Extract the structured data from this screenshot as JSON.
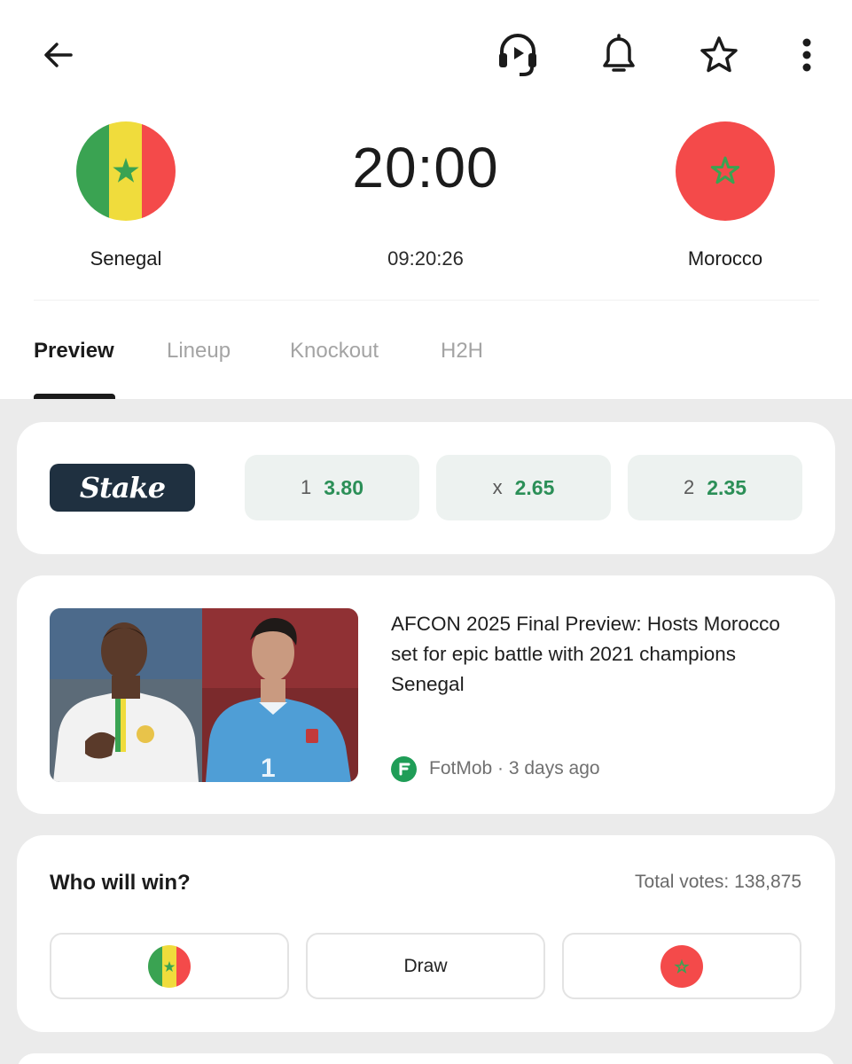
{
  "header": {
    "back_icon": "arrow-left-icon",
    "actions": [
      "headset-play-icon",
      "bell-icon",
      "star-icon",
      "more-vertical-icon"
    ]
  },
  "match": {
    "home_team": "Senegal",
    "away_team": "Morocco",
    "kickoff_time": "20:00",
    "countdown": "09:20:26"
  },
  "tabs": [
    {
      "label": "Preview",
      "active": true
    },
    {
      "label": "Lineup",
      "active": false
    },
    {
      "label": "Knockout",
      "active": false
    },
    {
      "label": "H2H",
      "active": false
    }
  ],
  "odds": {
    "bookmaker": "Stake",
    "home_label": "1",
    "home_value": "3.80",
    "draw_label": "x",
    "draw_value": "2.65",
    "away_label": "2",
    "away_value": "2.35"
  },
  "news": {
    "title": "AFCON 2025 Final Preview: Hosts Morocco set for epic battle with 2021 champions Senegal",
    "source": "FotMob · 3 days ago"
  },
  "poll": {
    "title": "Who will win?",
    "total_votes": "Total votes: 138,875",
    "draw_label": "Draw"
  },
  "colors": {
    "accent_green": "#2b8f57",
    "senegal_green": "#3aa352",
    "senegal_yellow": "#f0dc3c",
    "senegal_red": "#f44a4a",
    "morocco_red": "#f44a4a",
    "morocco_star": "#3aa352"
  }
}
